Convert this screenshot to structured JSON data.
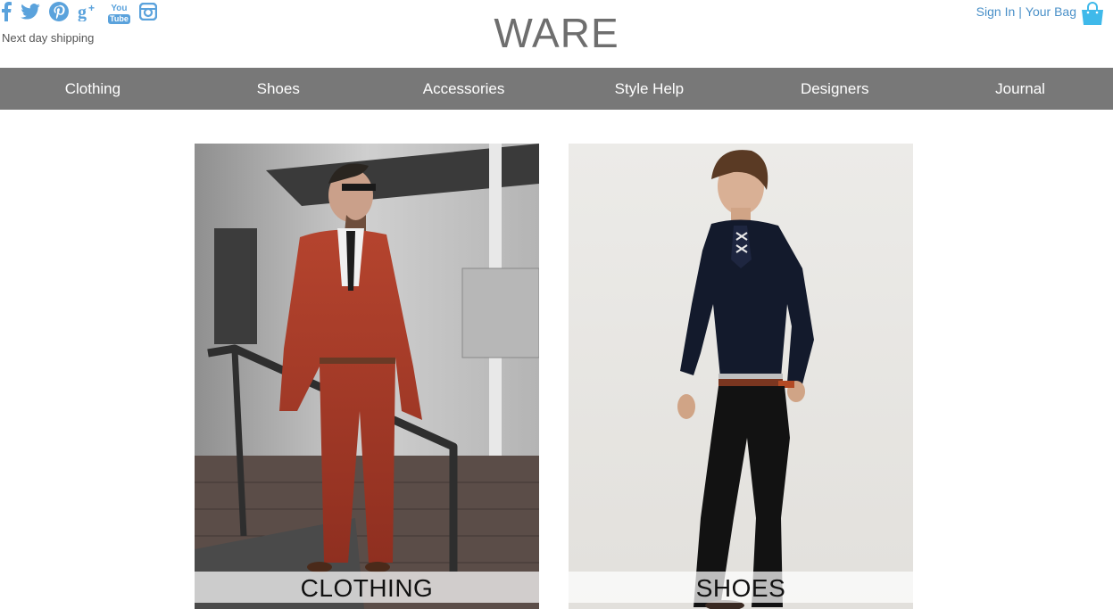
{
  "header": {
    "social_icons": [
      "facebook-icon",
      "twitter-icon",
      "pinterest-icon",
      "google-plus-icon",
      "youtube-icon",
      "instagram-icon"
    ],
    "youtube_text_top": "You",
    "youtube_text_bottom": "Tube",
    "shipping_text": "Next day shipping",
    "logo_text": "WARE",
    "sign_in": "Sign In",
    "separator": "|",
    "bag": "Your Bag"
  },
  "nav": {
    "items": [
      "Clothing",
      "Shoes",
      "Accessories",
      "Style Help",
      "Designers",
      "Journal"
    ]
  },
  "tiles": [
    {
      "caption": "CLOTHING"
    },
    {
      "caption": "SHOES"
    }
  ],
  "colors": {
    "accent": "#5aa2dc",
    "nav_bg": "#787878",
    "logo": "#6e6e6e",
    "bag_icon": "#3fb9ea"
  }
}
